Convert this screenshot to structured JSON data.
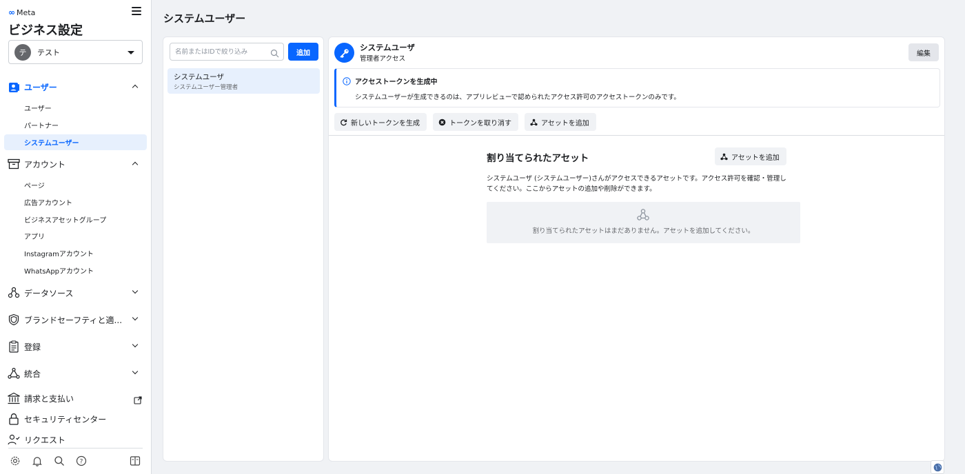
{
  "sidebar": {
    "logo_text": "Meta",
    "title": "ビジネス設定",
    "account": {
      "avatar_letter": "テ",
      "name": "テスト"
    },
    "sections": [
      {
        "label": "ユーザー",
        "items": [
          "ユーザー",
          "パートナー",
          "システムユーザー"
        ]
      },
      {
        "label": "アカウント",
        "items": [
          "ページ",
          "広告アカウント",
          "ビジネスアセットグループ",
          "アプリ",
          "Instagramアカウント",
          "WhatsAppアカウント"
        ]
      },
      {
        "label": "データソース"
      },
      {
        "label": "ブランドセーフティと適..."
      },
      {
        "label": "登録"
      },
      {
        "label": "統合"
      },
      {
        "label": "請求と支払い"
      },
      {
        "label": "セキュリティセンター"
      },
      {
        "label": "リクエスト"
      }
    ],
    "active_item": "システムユーザー"
  },
  "main": {
    "page_title": "システムユーザー",
    "search": {
      "placeholder": "名前またはIDで絞り込み",
      "value": ""
    },
    "add_button": "追加",
    "list": [
      {
        "name": "システムユーザ",
        "role": "システムユーザー管理者"
      }
    ],
    "detail": {
      "name": "システムユーザ",
      "access": "管理者アクセス",
      "edit_button": "編集",
      "banner": {
        "title": "アクセストークンを生成中",
        "body": "システムユーザーが生成できるのは、アプリレビューで認められたアクセス許可のアクセストークンのみです。"
      },
      "actions": {
        "generate": "新しいトークンを生成",
        "revoke": "トークンを取り消す",
        "add_assets": "アセットを追加"
      },
      "assets": {
        "title": "割り当てられたアセット",
        "add_button": "アセットを追加",
        "description": "システムユーザ (システムユーザー)さんがアクセスできるアセットです。アクセス許可を確認・管理してください。ここからアセットの追加や削除ができます。",
        "empty_text": "割り当てられたアセットはまだありません。アセットを追加してください。"
      }
    }
  },
  "colors": {
    "accent": "#0866ff",
    "background": "#f0f2f5",
    "active_bg": "#e7f0fd"
  }
}
